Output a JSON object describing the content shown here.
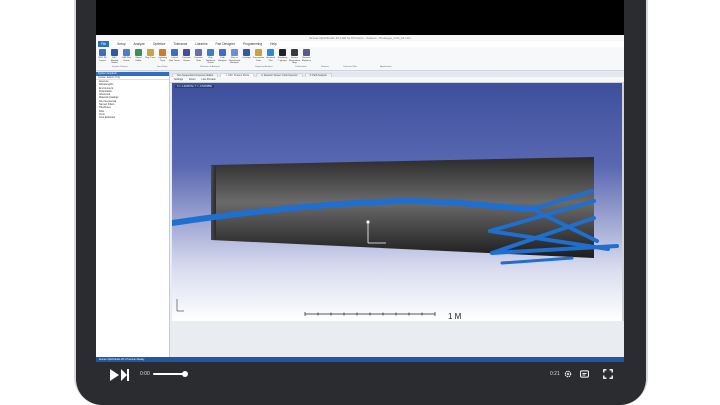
{
  "window": {
    "title": "Zemax OpticStudio 20.1 EE for Premium - Custom - Prototype_LCS_b1.zmx"
  },
  "menu": {
    "items": [
      "File",
      "Setup",
      "Analyze",
      "Optimize",
      "Tolerance",
      "Libraries",
      "Part Designer",
      "Programming",
      "Help"
    ]
  },
  "ribbon": {
    "buttons": [
      {
        "label": "NSC 3D Layout",
        "color": "#3a6fc4"
      },
      {
        "label": "NSC Shaded Model",
        "color": "#2b5aa8"
      },
      {
        "label": "CAD Part Viewer",
        "color": "#4a7fc4"
      },
      {
        "label": "Object Editor",
        "color": "#3d8f5a"
      },
      {
        "label": "Ray Trace",
        "color": "#c9a438"
      },
      {
        "label": "Lightning Trace",
        "color": "#d07a2a"
      },
      {
        "label": "Critical Ray Tracer",
        "color": "#3a6fc4"
      },
      {
        "label": "Detector Viewer",
        "color": "#4a4a9a"
      },
      {
        "label": "Detector Tools",
        "color": "#6a6ab0"
      },
      {
        "label": "Ray Database Viewer",
        "color": "#3a7fc4"
      },
      {
        "label": "Path Analysis",
        "color": "#3a6fc4"
      },
      {
        "label": "Flux vs Wavelength Analysis",
        "color": "#6a8fd4"
      },
      {
        "label": "Coatings",
        "color": "#2b5aa8"
      },
      {
        "label": "Prescription Data",
        "color": "#c9a438"
      },
      {
        "label": "Universal Plot",
        "color": "#2b8ad4"
      },
      {
        "label": "Roadmap Lighting",
        "color": "#222222"
      },
      {
        "label": "Source Illumination Map",
        "color": "#3a3a3a"
      },
      {
        "label": "Reverse Radiance",
        "color": "#5a5a8a"
      }
    ],
    "groups": [
      "System Viewers",
      "Trace Rays",
      "Detectors & Analysis",
      "Raytrace Analysis",
      "Polarization",
      "Reports",
      "Universal Plot",
      "Applications"
    ]
  },
  "left_panel": {
    "header": "System Explorer",
    "filter": "Update: Editors Only",
    "items": [
      "Aperture",
      "Wavelengths",
      "Environment",
      "Polarization",
      "Advanced",
      "Material Catalogs",
      "Non-Sequential",
      "Named Filters",
      "Title/Notes",
      "Files",
      "Units",
      "Cost Estimator"
    ]
  },
  "tabs": [
    {
      "label": "Non-Sequential Component Editor",
      "active": false
    },
    {
      "label": "1: NSC Shaded Model",
      "active": true
    },
    {
      "label": "2: Detector Viewer: Color Detector",
      "active": false
    },
    {
      "label": "3: Path Analysis",
      "active": false
    }
  ],
  "viewport_toolbar": {
    "settings": "Settings",
    "items": [
      "Zoom",
      "Live Preview"
    ]
  },
  "viewport": {
    "coord_readout": "X = 1.3234762, Y = -0.5370856",
    "scale_label": "1 M"
  },
  "status_bar": {
    "text": "Zemax OpticStudio 20.1 Premium  Ready"
  },
  "player": {
    "time_elapsed": "0:00",
    "time_remaining": "0:21",
    "progress_fraction": 0.05
  },
  "colors": {
    "rays": "#1e6fd0",
    "accent": "#2f6fbf"
  }
}
